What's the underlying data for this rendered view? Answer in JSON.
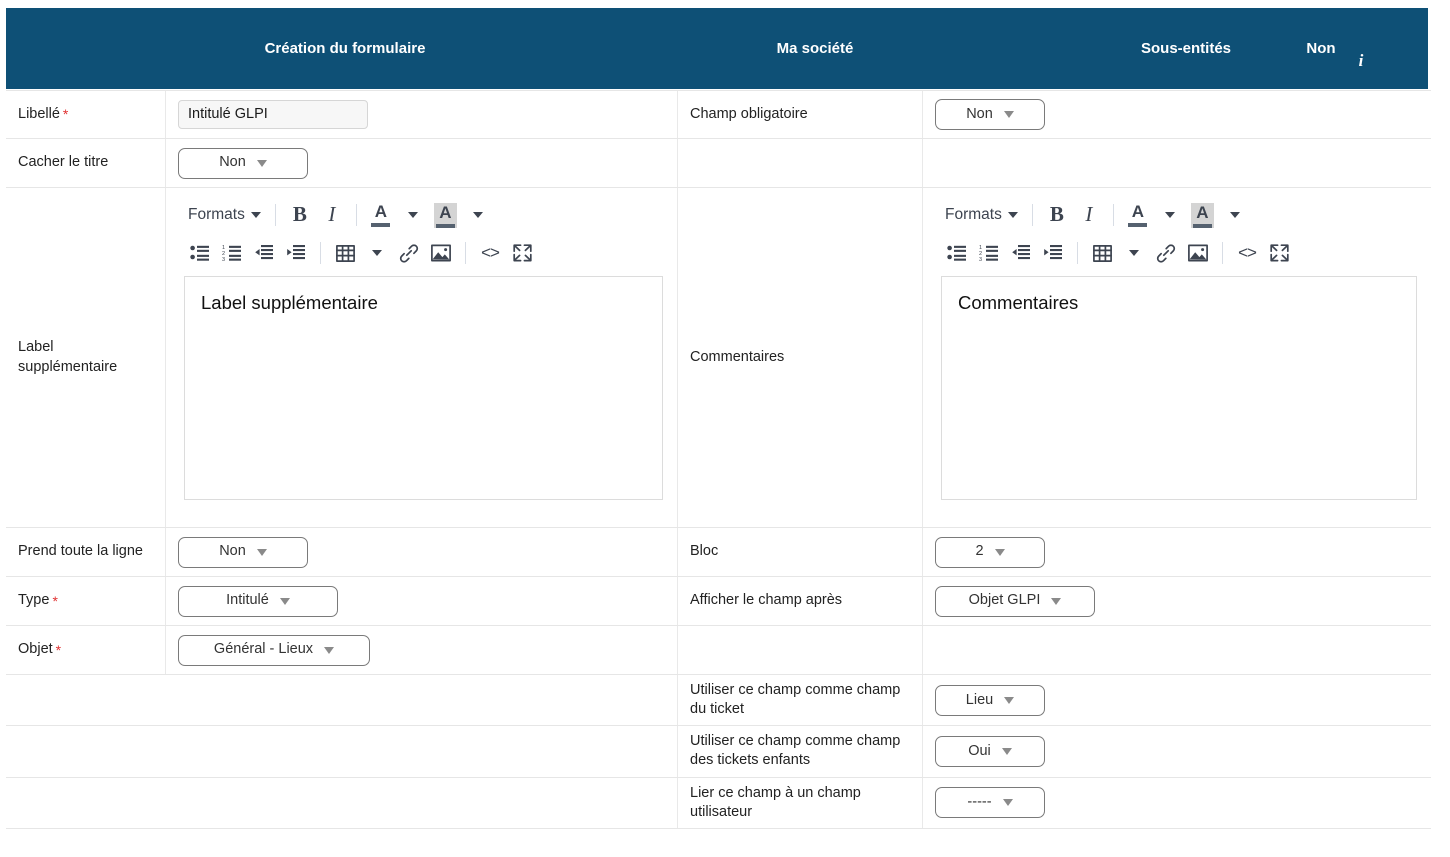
{
  "header": {
    "title": "Création du formulaire",
    "entity_label": "Ma société",
    "subentities_label": "Sous-entités",
    "subentities_value": "Non",
    "info_icon": "information-icon"
  },
  "colors": {
    "header_blue": "#0e5076",
    "required_red": "#e03131",
    "border_grey": "#e6e6e6",
    "input_bg": "#f7f7f7"
  },
  "editor_toolbar": {
    "formats_label": "Formats",
    "buttons": [
      "bold-icon",
      "italic-icon",
      "text-color-icon",
      "background-color-icon",
      "bullet-list-icon",
      "numbered-list-icon",
      "outdent-icon",
      "indent-icon",
      "table-icon",
      "link-icon",
      "image-icon",
      "source-code-icon",
      "fullscreen-icon"
    ]
  },
  "rows": [
    {
      "left_label": "Libellé",
      "left_required": true,
      "left_control": {
        "kind": "text",
        "value": "Intitulé GLPI"
      },
      "right_label": "Champ obligatoire",
      "right_control": {
        "kind": "select",
        "value": "Non",
        "width": "sm"
      }
    },
    {
      "left_label": "Cacher le titre",
      "left_required": false,
      "left_control": {
        "kind": "select",
        "value": "Non",
        "width": "md"
      },
      "right_label": "",
      "right_control": {
        "kind": "none"
      }
    },
    {
      "left_label": "Label supplémentaire",
      "left_required": false,
      "left_control": {
        "kind": "editor",
        "value": "Label supplémentaire"
      },
      "right_label": "Commentaires",
      "right_control": {
        "kind": "editor",
        "value": "Commentaires"
      }
    },
    {
      "left_label": "Prend toute la ligne",
      "left_required": false,
      "left_control": {
        "kind": "select",
        "value": "Non",
        "width": "md"
      },
      "right_label": "Bloc",
      "right_control": {
        "kind": "select",
        "value": "2",
        "width": "sm"
      }
    },
    {
      "left_label": "Type",
      "left_required": true,
      "left_control": {
        "kind": "select",
        "value": "Intitulé",
        "width": "lg"
      },
      "right_label": "Afficher le champ après",
      "right_control": {
        "kind": "select",
        "value": "Objet GLPI",
        "width": "lg"
      }
    },
    {
      "left_label": "Objet",
      "left_required": true,
      "left_control": {
        "kind": "select",
        "value": "Général - Lieux",
        "width": "xl"
      },
      "right_label": "",
      "right_control": {
        "kind": "none"
      }
    },
    {
      "left_label": "",
      "left_required": false,
      "left_control": {
        "kind": "none"
      },
      "right_label": "Utiliser ce champ comme champ du ticket",
      "right_control": {
        "kind": "select",
        "value": "Lieu",
        "width": "sm"
      }
    },
    {
      "left_label": "",
      "left_required": false,
      "left_control": {
        "kind": "none"
      },
      "right_label": "Utiliser ce champ comme champ des tickets enfants",
      "right_control": {
        "kind": "select",
        "value": "Oui",
        "width": "sm"
      }
    },
    {
      "left_label": "",
      "left_required": false,
      "left_control": {
        "kind": "none"
      },
      "right_label": "Lier ce champ à un champ utilisateur",
      "right_control": {
        "kind": "select",
        "value": "-----",
        "width": "sm"
      }
    }
  ]
}
